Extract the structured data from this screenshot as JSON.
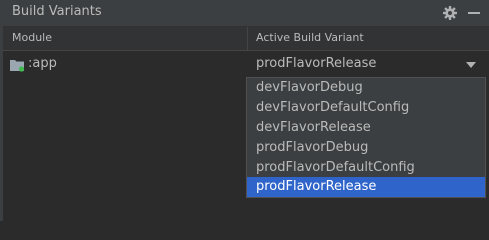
{
  "panel": {
    "title": "Build Variants"
  },
  "table": {
    "columns": [
      "Module",
      "Active Build Variant"
    ],
    "rows": [
      {
        "module": ":app",
        "variant": "prodFlavorRelease"
      }
    ]
  },
  "dropdown": {
    "options": [
      "devFlavorDebug",
      "devFlavorDefaultConfig",
      "devFlavorRelease",
      "prodFlavorDebug",
      "prodFlavorDefaultConfig",
      "prodFlavorRelease"
    ],
    "selected": "prodFlavorRelease"
  },
  "icons": {
    "settings": "gear-icon",
    "hide": "minimize-icon",
    "module": "folder-icon",
    "combo": "chevron-down-icon"
  },
  "colors": {
    "background": "#2b2b2b",
    "header": "#3c3f41",
    "text": "#bbbbbb",
    "selection": "#2f65ca",
    "module_dot": "#3fb950"
  }
}
